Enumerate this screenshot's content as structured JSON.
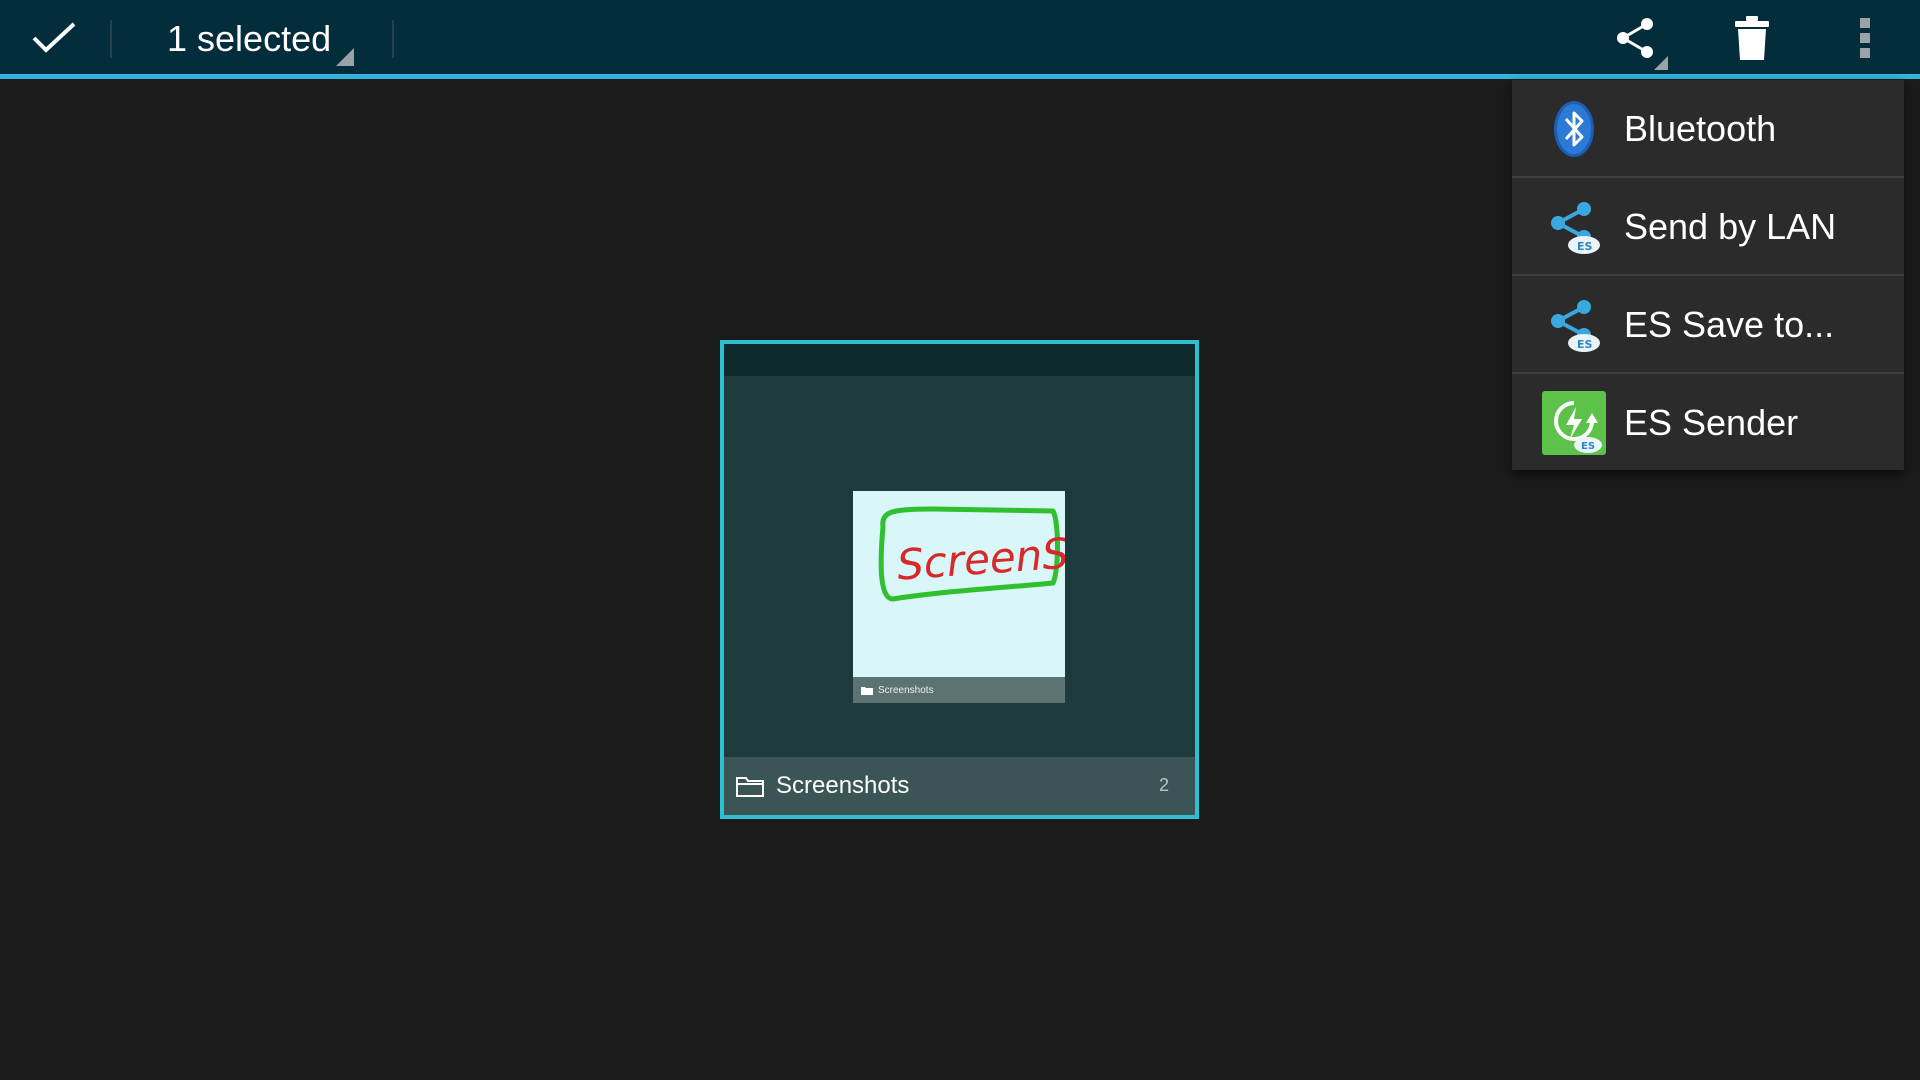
{
  "action_bar": {
    "selection_label": "1 selected",
    "done_icon": "checkmark-icon",
    "share_icon": "share-icon",
    "delete_icon": "trash-icon",
    "overflow_icon": "overflow-menu-icon",
    "accent_color": "#34b4dc"
  },
  "album": {
    "name": "Screenshots",
    "count": "2",
    "thumbnail": {
      "handwritten_text": "ScreenShot",
      "footer_label": "Screenshots"
    }
  },
  "share_menu": {
    "items": [
      {
        "label": "Bluetooth",
        "icon": "bluetooth-icon"
      },
      {
        "label": "Send by LAN",
        "icon": "es-share-icon"
      },
      {
        "label": "ES Save to...",
        "icon": "es-share-icon"
      },
      {
        "label": "ES Sender",
        "icon": "es-sender-icon"
      }
    ]
  }
}
